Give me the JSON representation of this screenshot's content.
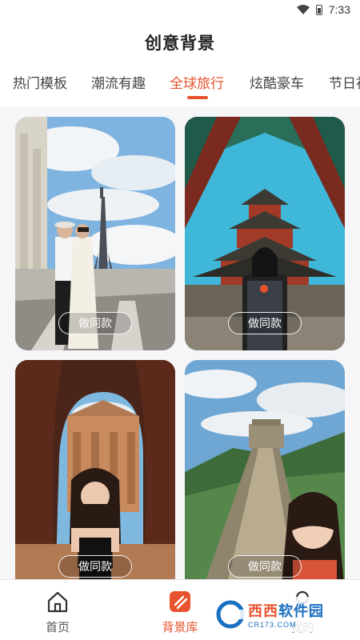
{
  "status_bar": {
    "time": "7:33",
    "icons": [
      "wifi-icon",
      "battery-icon"
    ]
  },
  "app": {
    "title": "创意背景"
  },
  "tabs": [
    {
      "label": "热门模板",
      "active": false
    },
    {
      "label": "潮流有趣",
      "active": false
    },
    {
      "label": "全球旅行",
      "active": true
    },
    {
      "label": "炫酷豪车",
      "active": false
    },
    {
      "label": "节日祝",
      "active": false
    }
  ],
  "cards": [
    {
      "scene": "paris-eiffel-tower",
      "button_label": "做同款"
    },
    {
      "scene": "summer-palace-pagoda",
      "button_label": "做同款"
    },
    {
      "scene": "petra-cave",
      "button_label": "做同款"
    },
    {
      "scene": "great-wall",
      "button_label": "做同款"
    }
  ],
  "bottom_nav": [
    {
      "label": "首页",
      "icon": "home-icon",
      "active": false
    },
    {
      "label": "背景库",
      "icon": "background-library-icon",
      "active": true
    },
    {
      "label": "我的",
      "icon": "profile-icon",
      "active": false
    }
  ],
  "watermark": {
    "text_red": "西西",
    "text_blue": "软件园",
    "url": "CR173.COM"
  },
  "colors": {
    "accent": "#e8532f",
    "background": "#f6f6f8"
  }
}
